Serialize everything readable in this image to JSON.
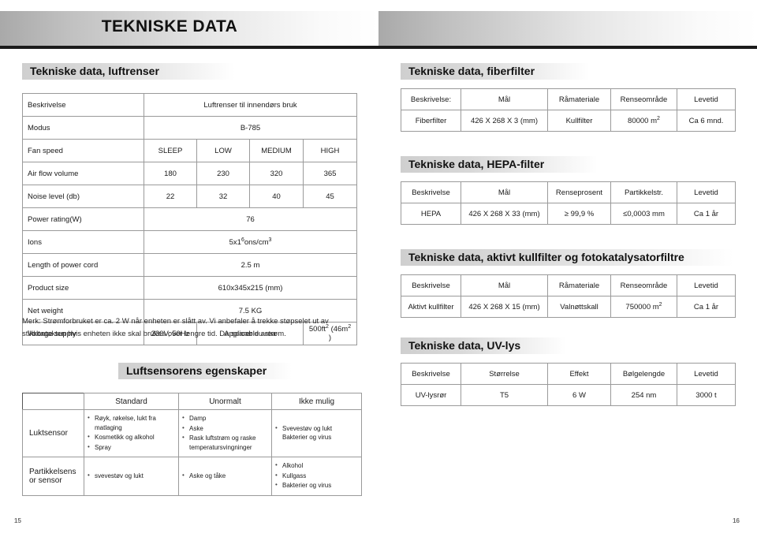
{
  "banner": {
    "title": "TEKNISKE DATA"
  },
  "left_page": {
    "section_heading": "Tekniske data, luftrenser",
    "spec_table": {
      "rows": [
        {
          "label": "Beskrivelse",
          "value": "Luftrenser til innendørs bruk"
        },
        {
          "label": "Modus",
          "value": "B-785"
        },
        {
          "label": "Fan speed",
          "cols": [
            "SLEEP",
            "LOW",
            "MEDIUM",
            "HIGH"
          ]
        },
        {
          "label": "Air flow volume",
          "cols": [
            "180",
            "230",
            "320",
            "365"
          ]
        },
        {
          "label": "Noise  level (db)",
          "cols": [
            "22",
            "32",
            "40",
            "45"
          ]
        },
        {
          "label": "Power rating(W)",
          "value": "76"
        },
        {
          "label": "Ions",
          "value_html": "5x1",
          "value_sup": "6",
          "value_tail": "ons/cm",
          "value_sup2": "3"
        },
        {
          "label": "Length of power cord",
          "value": "2.5 m"
        },
        {
          "label": "Product size",
          "value": "610x345x215 (mm)"
        },
        {
          "label": "Net  weight",
          "value": "7.5 KG"
        }
      ],
      "voltage_row": {
        "label": "Voltage supply",
        "voltage": "230V, 50Hz",
        "area_label": "Applicable area",
        "area_value_a": "500ft",
        "area_sup_a": "2",
        "area_value_b": " (46m",
        "area_sup_b": "2",
        "area_value_c": " )"
      }
    },
    "note": "Merk: Strømforbruket er ca. 2 W når enheten er slått av. Vi anbefaler å trekke støpselet ut av stikkontakten hvis enheten ikke skal brukes over lengre tid. Da sparer du strøm.",
    "sensor_heading": "Luftsensorens egenskaper",
    "sensor_table": {
      "columns": [
        "",
        "Standard",
        "Unormalt",
        "Ikke mulig"
      ],
      "rows": [
        {
          "label": "Luktsensor",
          "standard": [
            "Røyk, røkelse, lukt fra matlaging",
            "Kosmetikk og alkohol",
            "Spray"
          ],
          "unormalt": [
            "Damp",
            "Aske",
            "Rask luftstrøm og raske temperatursvingninger"
          ],
          "ikke_mulig": [
            "Svevestøv og lukt Bakterier og virus"
          ]
        },
        {
          "label": "Partikkelsens or sensor",
          "standard": [
            "svevestøv og lukt"
          ],
          "unormalt": [
            "Aske og tåke"
          ],
          "ikke_mulig": [
            "Alkohol",
            "Kullgass",
            "Bakterier og virus"
          ]
        }
      ]
    },
    "page_number": "15"
  },
  "right_page": {
    "fiberfilter": {
      "heading": "Tekniske data, fiberfilter",
      "headers": [
        "Beskrivelse:",
        "Mål",
        "Råmateriale",
        "Renseområde",
        "Levetid"
      ],
      "row": {
        "beskrivelse": "Fiberfilter",
        "mal": "426 X 268 X 3 (mm)",
        "ramateriale": "Kullfilter",
        "renseomrade": "80000 m",
        "renseomrade_sup": "2",
        "levetid": "Ca 6 mnd."
      }
    },
    "hepa": {
      "heading": "Tekniske data, HEPA-filter",
      "headers": [
        "Beskrivelse",
        "Mål",
        "Renseprosent",
        "Partikkelstr.",
        "Levetid"
      ],
      "row": {
        "beskrivelse": "HEPA",
        "mal": "426 X 268 X 33 (mm)",
        "renseprosent": "≥ 99,9 %",
        "partikkelstr": "≤0,0003 mm",
        "levetid": "Ca 1 år"
      }
    },
    "kullfilter": {
      "heading": "Tekniske data, aktivt kullfilter og fotokatalysatorfiltre",
      "headers": [
        "Beskrivelse",
        "Mål",
        "Råmateriale",
        "Renseområde",
        "Levetid"
      ],
      "row": {
        "beskrivelse": "Aktivt kullfilter",
        "mal": "426 X 268 X 15 (mm)",
        "ramateriale": "Valnøttskall",
        "renseomrade": "750000 m",
        "renseomrade_sup": "2",
        "levetid": "Ca 1 år"
      }
    },
    "uv": {
      "heading": "Tekniske data, UV-lys",
      "headers": [
        "Beskrivelse",
        "Størrelse",
        "Effekt",
        "Bølgelengde",
        "Levetid"
      ],
      "row": {
        "beskrivelse": "UV-lysrør",
        "storrelse": "T5",
        "effekt": "6 W",
        "bolgelengde": "254 nm",
        "levetid": "3000 t"
      }
    },
    "page_number": "16"
  }
}
